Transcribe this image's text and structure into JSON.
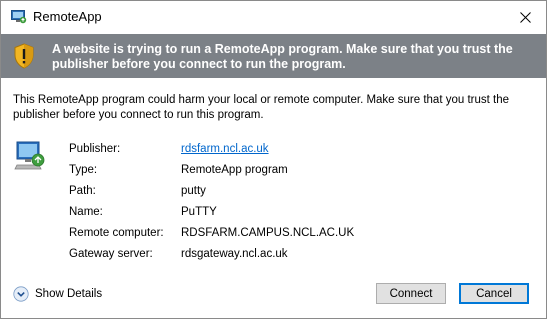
{
  "window": {
    "title": "RemoteApp",
    "close_icon": "close-icon"
  },
  "banner": {
    "icon": "shield-warning-icon",
    "text": "A website is trying to run a RemoteApp program. Make sure that you trust the publisher before you connect to run the program.",
    "background_color": "#7c8187"
  },
  "description": "This RemoteApp program could harm your local or remote computer. Make sure that you trust the publisher before you connect to run this program.",
  "details": {
    "icon": "remote-computer-icon",
    "rows": [
      {
        "label": "Publisher:",
        "value": "rdsfarm.ncl.ac.uk",
        "is_link": true
      },
      {
        "label": "Type:",
        "value": "RemoteApp program"
      },
      {
        "label": "Path:",
        "value": "putty"
      },
      {
        "label": "Name:",
        "value": "PuTTY"
      },
      {
        "label": "Remote computer:",
        "value": "RDSFARM.CAMPUS.NCL.AC.UK"
      },
      {
        "label": "Gateway server:",
        "value": "rdsgateway.ncl.ac.uk"
      }
    ]
  },
  "footer": {
    "show_details_label": "Show Details",
    "show_details_icon": "chevron-down-circle-icon",
    "connect_label": "Connect",
    "cancel_label": "Cancel"
  }
}
